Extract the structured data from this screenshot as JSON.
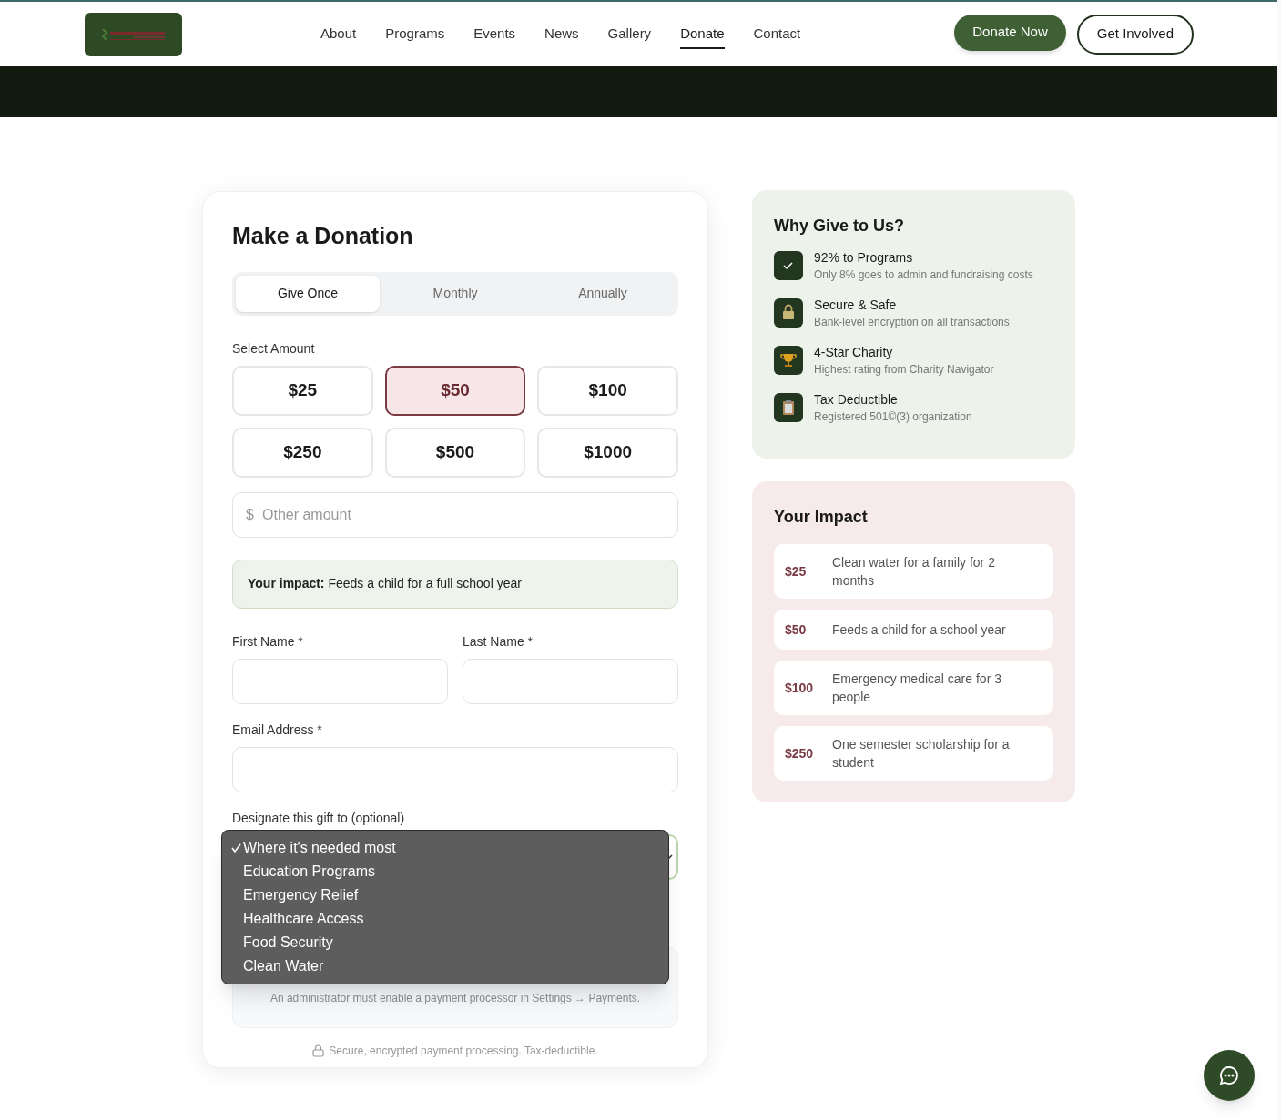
{
  "nav": {
    "links": [
      {
        "label": "About",
        "selected": false
      },
      {
        "label": "Programs",
        "selected": false
      },
      {
        "label": "Events",
        "selected": false
      },
      {
        "label": "News",
        "selected": false
      },
      {
        "label": "Gallery",
        "selected": false
      },
      {
        "label": "Donate",
        "selected": true
      },
      {
        "label": "Contact",
        "selected": false
      }
    ],
    "buttons": [
      {
        "label": "Donate Now",
        "kind": "primary"
      },
      {
        "label": "Get Involved",
        "kind": "outline"
      }
    ]
  },
  "form": {
    "title": "Make a Donation",
    "frequency": [
      {
        "label": "Give Once",
        "selected": true
      },
      {
        "label": "Monthly",
        "selected": false
      },
      {
        "label": "Annually",
        "selected": false
      }
    ],
    "amount_label": "Select Amount",
    "amounts": [
      {
        "label": "$25",
        "selected": false
      },
      {
        "label": "$50",
        "selected": true
      },
      {
        "label": "$100",
        "selected": false
      },
      {
        "label": "$250",
        "selected": false
      },
      {
        "label": "$500",
        "selected": false
      },
      {
        "label": "$1000",
        "selected": false
      }
    ],
    "other_amount": {
      "prefix": "$",
      "placeholder": "Other amount"
    },
    "impact_note": "**Your impact:** Feeds a child for a full school year",
    "first_name": {
      "label": "First Name *"
    },
    "last_name": {
      "label": "Last Name *"
    },
    "email": {
      "label": "Email Address *"
    },
    "designation": {
      "label": "Designate this gift to (optional)",
      "expanded": true,
      "options": [
        {
          "label": "Where it's needed most",
          "selected": true
        },
        {
          "label": "Education Programs",
          "selected": false
        },
        {
          "label": "Emergency Relief",
          "selected": false
        },
        {
          "label": "Healthcare Access",
          "selected": false
        },
        {
          "label": "Food Security",
          "selected": false
        },
        {
          "label": "Clean Water",
          "selected": false
        }
      ]
    },
    "notice": "An administrator must enable a payment processor in Settings → Payments.",
    "footer": "Secure, encrypted payment processing. Tax-deductible."
  },
  "why": {
    "title": "Why Give to Us?",
    "items": [
      {
        "kind": "check",
        "title": "92% to Programs",
        "text": "Only 8% goes to admin and fundraising costs"
      },
      {
        "kind": "lock",
        "title": "Secure & Safe",
        "text": "Bank-level encryption on all transactions"
      },
      {
        "kind": "trophy",
        "title": "4-Star Charity",
        "text": "Highest rating from Charity Navigator"
      },
      {
        "kind": "clipboard",
        "title": "Tax Deductible",
        "text": "Registered 501©(3) organization"
      }
    ]
  },
  "impact": {
    "title": "Your Impact",
    "rows": [
      {
        "amount": "$25",
        "text": "Clean water for a family for 2 months"
      },
      {
        "amount": "$50",
        "text": "Feeds a child for a school year"
      },
      {
        "amount": "$100",
        "text": "Emergency medical care for 3 people"
      },
      {
        "amount": "$250",
        "text": "One semester scholarship for a student"
      }
    ]
  }
}
